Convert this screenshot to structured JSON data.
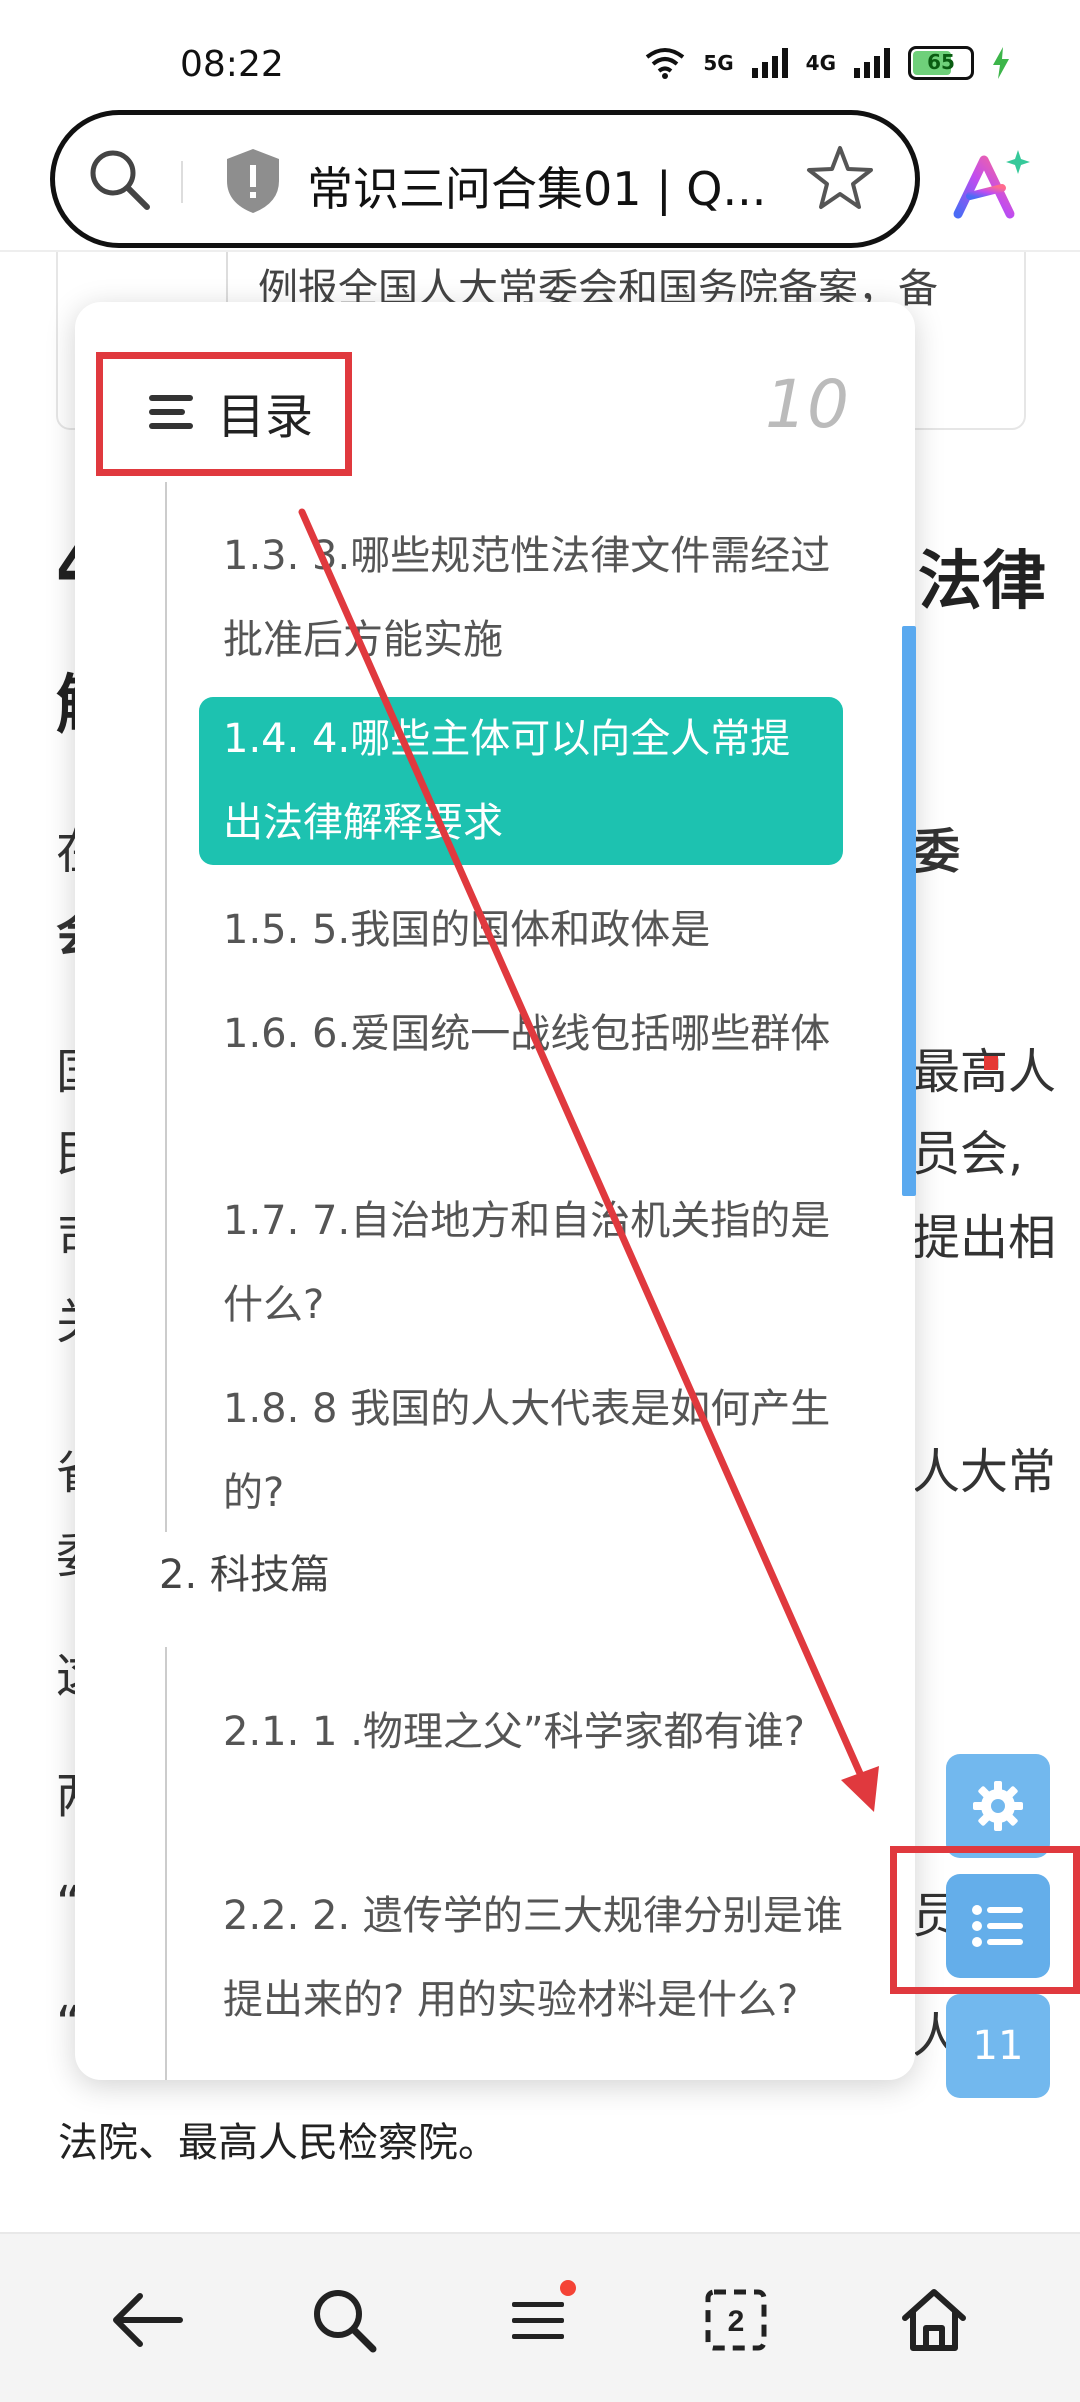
{
  "status_bar": {
    "time": "08:22",
    "net1": "5G",
    "net2": "4G",
    "battery": "65"
  },
  "address_bar": {
    "title": "常识三问合集01 | Q..."
  },
  "article": {
    "card_text": "例报全国人大常委会和国务院备案，备",
    "heading_left_1": "4",
    "heading_right_1": "法律",
    "heading_left_2": "解",
    "frag_l1": "在",
    "frag_r1": "委",
    "frag_l2": "会",
    "frag_l3": "国",
    "frag_r3": "最高人",
    "frag_l4": "民",
    "frag_r4": "员会,",
    "frag_l5": "司",
    "frag_r5": "提出相",
    "frag_l6": "关",
    "frag_l7": "省",
    "frag_r7": "人大常",
    "frag_l8": "委",
    "frag_l9": "这",
    "frag_l10": "两",
    "frag_l11": "“",
    "frag_r11": "员会:",
    "frag_l12": "“",
    "frag_r12": "人民",
    "last_line": "法院、最高人民检察院。"
  },
  "toc": {
    "title": "目录",
    "page": "10",
    "items": [
      "1.3. 3.哪些规范性法律文件需经过批准后方能实施",
      "1.4. 4.哪些主体可以向全人常提出法律解释要求",
      "1.5. 5.我国的国体和政体是",
      "1.6. 6.爱国统一战线包括哪些群体",
      "1.7. 7.自治地方和自治机关指的是什么?",
      "1.8. 8 我国的人大代表是如何产生的?",
      "2. 科技篇",
      "2.1. 1 .物理之父”科学家都有谁?",
      "2.2. 2. 遗传学的三大规律分别是谁提出来的? 用的实验材料是什么?"
    ]
  },
  "fab": {
    "page": "11"
  },
  "colors": {
    "active": "#1dc2b0",
    "annotation": "#e0393e",
    "fab": "#72b8ee"
  }
}
